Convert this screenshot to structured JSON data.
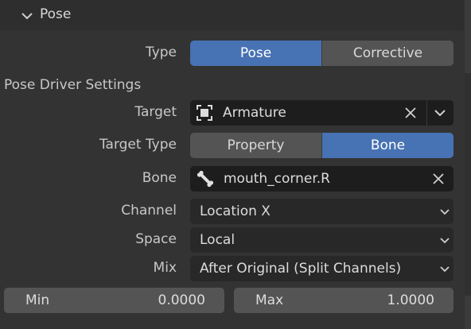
{
  "panel": {
    "title": "Pose",
    "icons": {
      "collapse": "chevron-down-icon"
    }
  },
  "type_row": {
    "label": "Type",
    "options": [
      "Pose",
      "Corrective"
    ],
    "selected": "Pose"
  },
  "section": {
    "title": "Pose Driver Settings"
  },
  "target": {
    "label": "Target",
    "value": "Armature",
    "icon": "armature-object-icon"
  },
  "target_type": {
    "label": "Target Type",
    "options": [
      "Property",
      "Bone"
    ],
    "selected": "Bone"
  },
  "bone": {
    "label": "Bone",
    "value": "mouth_corner.R",
    "icon": "bone-icon"
  },
  "channel": {
    "label": "Channel",
    "value": "Location X"
  },
  "space": {
    "label": "Space",
    "value": "Local"
  },
  "mix": {
    "label": "Mix",
    "value": "After Original (Split Channels)"
  },
  "min": {
    "label": "Min",
    "value": "0.0000"
  },
  "max": {
    "label": "Max",
    "value": "1.0000"
  },
  "colors": {
    "accent": "#4772b3",
    "background": "#333333",
    "field": "#1d1d1d",
    "button": "#545454"
  }
}
